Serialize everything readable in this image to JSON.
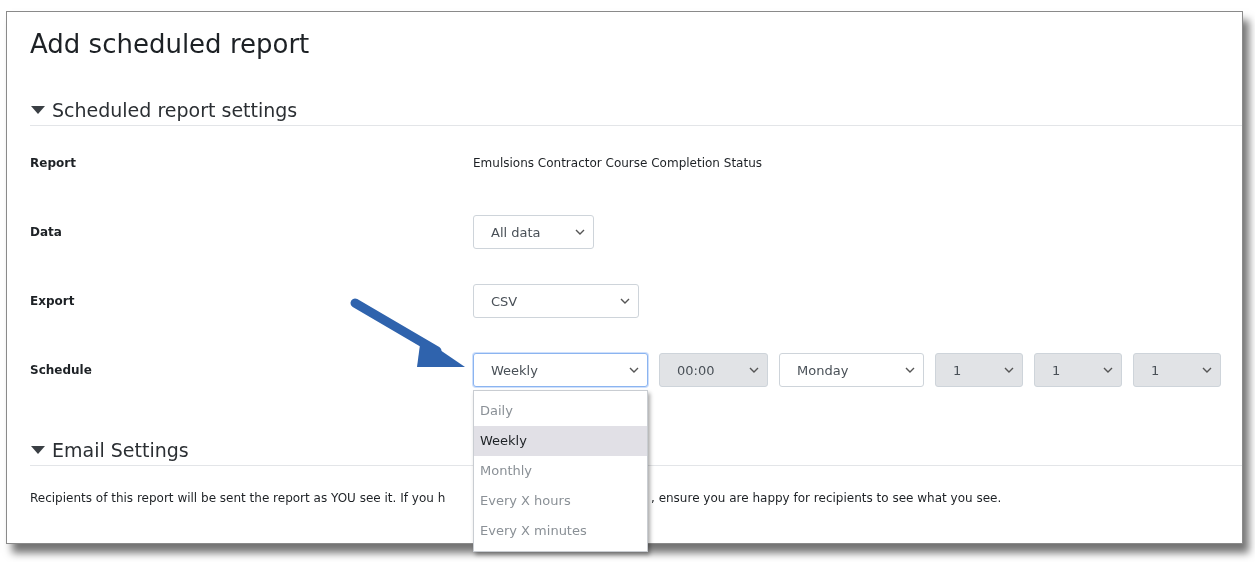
{
  "page": {
    "title": "Add scheduled report"
  },
  "sections": [
    {
      "title": "Scheduled report settings",
      "expanded": true,
      "fields": [
        {
          "label": "Report",
          "kind": "text",
          "value": "Emulsions Contractor Course Completion Status"
        },
        {
          "label": "Data",
          "kind": "select",
          "controls": [
            {
              "value": "All data",
              "disabled": false,
              "focused": false
            }
          ]
        },
        {
          "label": "Export",
          "kind": "select",
          "controls": [
            {
              "value": "CSV",
              "disabled": false,
              "focused": false
            }
          ]
        },
        {
          "label": "Schedule",
          "kind": "select",
          "controls": [
            {
              "value": "Weekly",
              "disabled": false,
              "focused": true,
              "options": [
                {
                  "label": "Daily",
                  "selected": false
                },
                {
                  "label": "Weekly",
                  "selected": true
                },
                {
                  "label": "Monthly",
                  "selected": false
                },
                {
                  "label": "Every X hours",
                  "selected": false
                },
                {
                  "label": "Every X minutes",
                  "selected": false
                }
              ]
            },
            {
              "value": "00:00",
              "disabled": true,
              "focused": false
            },
            {
              "value": "Monday",
              "disabled": false,
              "focused": false
            },
            {
              "value": "1",
              "disabled": true,
              "focused": false
            },
            {
              "value": "1",
              "disabled": true,
              "focused": false
            },
            {
              "value": "1",
              "disabled": true,
              "focused": false
            }
          ]
        }
      ]
    },
    {
      "title": "Email Settings",
      "expanded": true,
      "note_parts": [
        "Recipients of this report will be sent the report as YOU see it. If you h",
        ", ensure you are happy for recipients to see what you see."
      ]
    }
  ]
}
